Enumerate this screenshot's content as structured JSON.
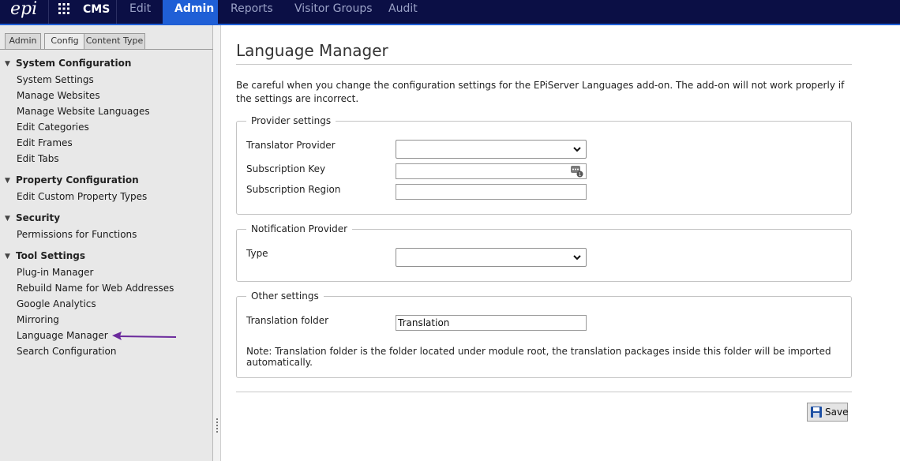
{
  "topbar": {
    "logo_text": "epi",
    "product": "CMS",
    "tabs": [
      {
        "label": "Edit"
      },
      {
        "label": "Admin"
      },
      {
        "label": "Reports"
      },
      {
        "label": "Visitor Groups"
      },
      {
        "label": "Audit"
      }
    ],
    "active_tab": "Admin",
    "accent_color": "#1f5fd6",
    "background_color": "#0b0f45"
  },
  "sidebar": {
    "tabs": [
      {
        "label": "Admin"
      },
      {
        "label": "Config"
      },
      {
        "label": "Content Type"
      }
    ],
    "active_tab": "Config",
    "sections": [
      {
        "title": "System Configuration",
        "items": [
          "System Settings",
          "Manage Websites",
          "Manage Website Languages",
          "Edit Categories",
          "Edit Frames",
          "Edit Tabs"
        ]
      },
      {
        "title": "Property Configuration",
        "items": [
          "Edit Custom Property Types"
        ]
      },
      {
        "title": "Security",
        "items": [
          "Permissions for Functions"
        ]
      },
      {
        "title": "Tool Settings",
        "items": [
          "Plug-in Manager",
          "Rebuild Name for Web Addresses",
          "Google Analytics",
          "Mirroring",
          "Language Manager",
          "Search Configuration"
        ]
      }
    ],
    "highlight_arrow_color": "#6b2a9c"
  },
  "main": {
    "title": "Language Manager",
    "intro": "Be careful when you change the configuration settings for the EPiServer Languages add-on. The add-on will not work properly if the settings are incorrect.",
    "provider_settings": {
      "legend": "Provider settings",
      "translator_provider_label": "Translator Provider",
      "translator_provider_value": "",
      "subscription_key_label": "Subscription Key",
      "subscription_key_value": "",
      "subscription_region_label": "Subscription Region",
      "subscription_region_value": ""
    },
    "notification_provider": {
      "legend": "Notification Provider",
      "type_label": "Type",
      "type_value": ""
    },
    "other_settings": {
      "legend": "Other settings",
      "translation_folder_label": "Translation folder",
      "translation_folder_value": "Translation",
      "note": "Note: Translation folder is the folder located under module root, the translation packages inside this folder will be imported automatically."
    },
    "save_label": "Save"
  }
}
